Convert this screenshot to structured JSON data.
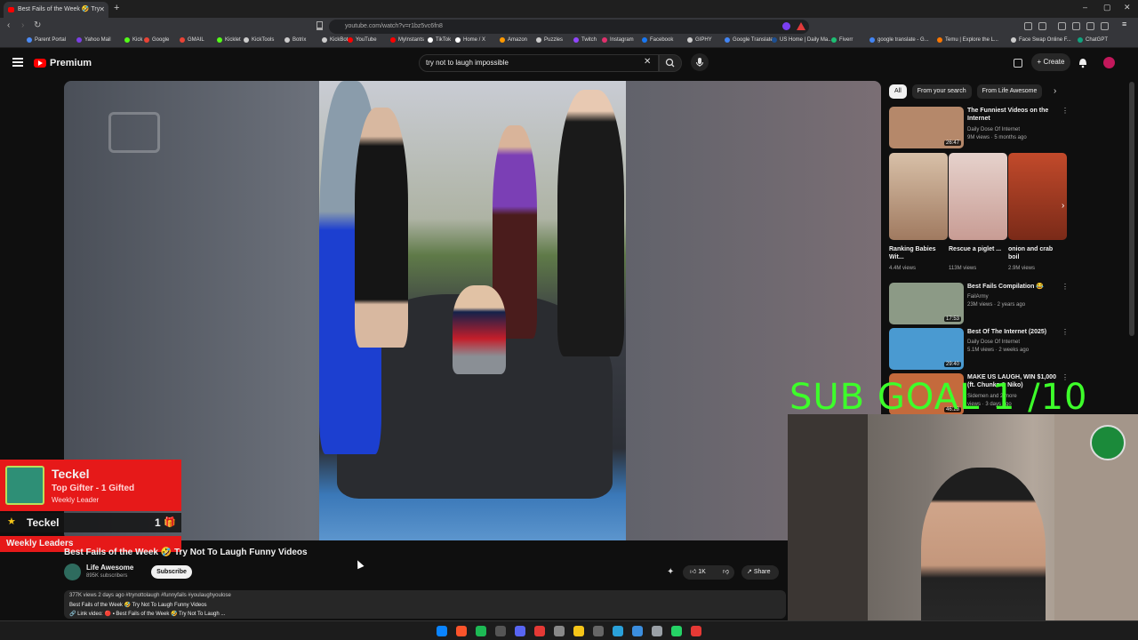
{
  "browser": {
    "tab_title": "Best Fails of the Week 🤣 Try",
    "new_tab": "+",
    "window_controls": [
      "–",
      "▢",
      "✕"
    ],
    "url": "youtube.com/watch?v=r1bz5vc6fn8"
  },
  "bookmarks": [
    {
      "label": "Parent Portal",
      "color": "#4c8bf5"
    },
    {
      "label": "Yahoo Mail",
      "color": "#7b3fe4"
    },
    {
      "label": "Kick",
      "color": "#53fc18"
    },
    {
      "label": "Google",
      "color": "#ea4335"
    },
    {
      "label": "GMAIL",
      "color": "#ea4335"
    },
    {
      "label": "Kicklet",
      "color": "#53fc18"
    },
    {
      "label": "KickTools",
      "color": "#cccccc"
    },
    {
      "label": "Botrix",
      "color": "#cccccc"
    },
    {
      "label": "KickBot",
      "color": "#cccccc"
    },
    {
      "label": "YouTube",
      "color": "#ff0000"
    },
    {
      "label": "MyInstants",
      "color": "#ff0000"
    },
    {
      "label": "TikTok",
      "color": "#ffffff"
    },
    {
      "label": "Home / X",
      "color": "#ffffff"
    },
    {
      "label": "Amazon",
      "color": "#ff9900"
    },
    {
      "label": "Puzzles",
      "color": "#cccccc"
    },
    {
      "label": "Twitch",
      "color": "#9146ff"
    },
    {
      "label": "Instagram",
      "color": "#e1306c"
    },
    {
      "label": "Facebook",
      "color": "#1877f2"
    },
    {
      "label": "GIPHY",
      "color": "#cccccc"
    },
    {
      "label": "Google Translate",
      "color": "#4285f4"
    },
    {
      "label": "US Home | Daily Ma...",
      "color": "#1d4f91"
    },
    {
      "label": "Fiverr",
      "color": "#1dbf73"
    },
    {
      "label": "google translate - G...",
      "color": "#4285f4"
    },
    {
      "label": "Temu | Explore the L...",
      "color": "#fb7701"
    },
    {
      "label": "Face Swap Online F...",
      "color": "#cccccc"
    },
    {
      "label": "ChatGPT",
      "color": "#10a37f"
    }
  ],
  "youtube": {
    "logo_text": "Premium",
    "search_value": "try not to laugh impossible",
    "create_label": "Create"
  },
  "chips": [
    "All",
    "From your search",
    "From Life Awesome"
  ],
  "recommendations": [
    {
      "title": "The Funniest Videos on the Internet",
      "channel": "Daily Dose Of Internet",
      "meta": "9M views · 5 months ago",
      "duration": "26:47",
      "color": "#b5886a"
    },
    {
      "title": "Best Fails Compilation 😂",
      "channel": "FailArmy",
      "meta": "23M views · 2 years ago",
      "duration": "17:53",
      "color": "#8c9a86"
    },
    {
      "title": "Best Of The Internet (2025)",
      "channel": "Daily Dose Of Internet",
      "meta": "5.1M views · 2 weeks ago",
      "duration": "29:40",
      "color": "#4a9ad1"
    },
    {
      "title": "MAKE US LAUGH, WIN $1,000 (ft. Chunkz & Niko)",
      "channel": "Sidemen and 2 more",
      "meta": "views · 3 days ago",
      "duration": "46:28",
      "color": "#c46a3c"
    }
  ],
  "shorts": [
    {
      "title": "Ranking Babies Wit...",
      "views": "4.4M views",
      "color": "#c9a28c"
    },
    {
      "title": "Rescue a piglet ...",
      "views": "113M views",
      "color": "#d9b7b0"
    },
    {
      "title": "onion and crab boil",
      "views": "2.9M views",
      "color": "#b0472a"
    }
  ],
  "overlay": {
    "sub_goal": "SUB GOAL 1 /10",
    "alert_name": "Teckel",
    "alert_title": "Top Gifter - 1 Gifted",
    "alert_sub": "Weekly Leader",
    "leader_name": "Teckel",
    "leader_count": "1",
    "weekly_leaders": "Weekly Leaders"
  },
  "video": {
    "title": "Best Fails of the Week 🤣 Try Not To Laugh Funny Videos",
    "channel": "Life Awesome",
    "subscribers": "895K subscribers",
    "subscribe_label": "Subscribe",
    "likes": "1K",
    "share_label": "Share",
    "desc_meta": "377K views  2 days ago  #trynottolaugh #funnyfails #youlaughyoulose",
    "desc_line2": "Best Fails of the Week 🤣 Try Not To Laugh Funny Videos",
    "desc_line3": "🔗 Link video: 🔴 ▪ Best Fails of the Week 🤣 Try Not To Laugh ..."
  },
  "taskbar_icons": [
    {
      "name": "windows-start-icon",
      "color": "#0a84ff"
    },
    {
      "name": "brave-browser-icon",
      "color": "#fb542b"
    },
    {
      "name": "spotify-icon",
      "color": "#1db954"
    },
    {
      "name": "calculator-icon",
      "color": "#555555"
    },
    {
      "name": "discord-icon",
      "color": "#5865f2"
    },
    {
      "name": "pin-icon",
      "color": "#e53935"
    },
    {
      "name": "github-icon",
      "color": "#888888"
    },
    {
      "name": "file-explorer-icon",
      "color": "#f5c518"
    },
    {
      "name": "app-icon",
      "color": "#666666"
    },
    {
      "name": "telegram-icon",
      "color": "#2aa1da"
    },
    {
      "name": "photos-icon",
      "color": "#3b8ede"
    },
    {
      "name": "settings-icon",
      "color": "#9aa0a6"
    },
    {
      "name": "whatsapp-icon",
      "color": "#25d366"
    },
    {
      "name": "maps-icon",
      "color": "#e53935"
    }
  ]
}
